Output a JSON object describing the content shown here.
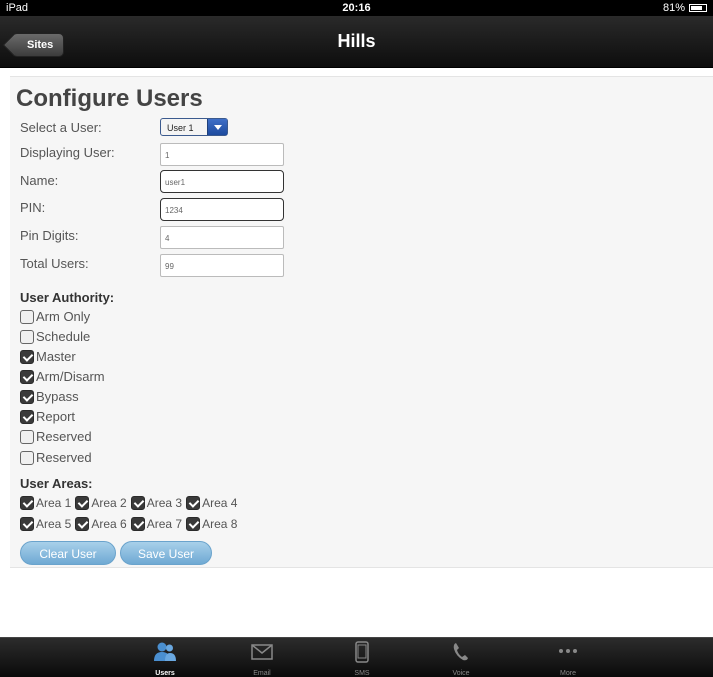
{
  "status_bar": {
    "device": "iPad",
    "time": "20:16",
    "battery_text": "81%",
    "battery_level": 0.81
  },
  "nav": {
    "back_label": "Sites",
    "title": "Hills"
  },
  "page": {
    "title": "Configure Users"
  },
  "form": {
    "select_user": {
      "label": "Select a User:",
      "value": "User 1"
    },
    "displaying_user": {
      "label": "Displaying User:",
      "value": "1"
    },
    "name": {
      "label": "Name:",
      "value": "user1"
    },
    "pin": {
      "label": "PIN:",
      "value": "1234"
    },
    "pin_digits": {
      "label": "Pin Digits:",
      "value": "4"
    },
    "total_users": {
      "label": "Total Users:",
      "value": "99"
    }
  },
  "authority": {
    "heading": "User Authority:",
    "items": [
      {
        "label": "Arm Only",
        "checked": false
      },
      {
        "label": "Schedule",
        "checked": false
      },
      {
        "label": "Master",
        "checked": true
      },
      {
        "label": "Arm/Disarm",
        "checked": true
      },
      {
        "label": "Bypass",
        "checked": true
      },
      {
        "label": "Report",
        "checked": true
      },
      {
        "label": "Reserved",
        "checked": false
      },
      {
        "label": "Reserved",
        "checked": false
      }
    ]
  },
  "areas": {
    "heading": "User Areas:",
    "items": [
      {
        "label": "Area 1",
        "checked": true
      },
      {
        "label": "Area 2",
        "checked": true
      },
      {
        "label": "Area 3",
        "checked": true
      },
      {
        "label": "Area 4",
        "checked": true
      },
      {
        "label": "Area 5",
        "checked": true
      },
      {
        "label": "Area 6",
        "checked": true
      },
      {
        "label": "Area 7",
        "checked": true
      },
      {
        "label": "Area 8",
        "checked": true
      }
    ]
  },
  "buttons": {
    "clear": "Clear User",
    "save": "Save User"
  },
  "tabs": [
    {
      "label": "Users",
      "icon": "users-icon",
      "active": true
    },
    {
      "label": "Email",
      "icon": "email-icon",
      "active": false
    },
    {
      "label": "SMS",
      "icon": "sms-icon",
      "active": false
    },
    {
      "label": "Voice",
      "icon": "phone-icon",
      "active": false
    },
    {
      "label": "More",
      "icon": "more-icon",
      "active": false
    }
  ],
  "colors": {
    "accent": "#3f6fc7",
    "button": "#8ec0e2",
    "active_tab_icon": "#4a8fd0"
  }
}
